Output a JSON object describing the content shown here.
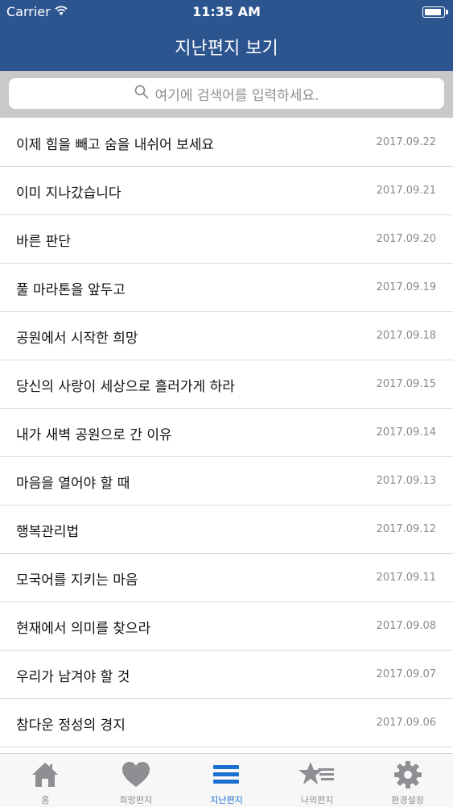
{
  "status_bar": {
    "carrier": "Carrier",
    "time": "11:35 AM"
  },
  "header": {
    "title": "지난편지 보기"
  },
  "search": {
    "placeholder": "여기에 검색어를 입력하세요."
  },
  "letters": [
    {
      "title": "이제 힘을 빼고 숨을 내쉬어 보세요",
      "date": "2017.09.22"
    },
    {
      "title": "이미 지나갔습니다",
      "date": "2017.09.21"
    },
    {
      "title": "바른 판단",
      "date": "2017.09.20"
    },
    {
      "title": "풀 마라톤을 앞두고",
      "date": "2017.09.19"
    },
    {
      "title": "공원에서 시작한 희망",
      "date": "2017.09.18"
    },
    {
      "title": "당신의 사랑이 세상으로 흘러가게 하라",
      "date": "2017.09.15"
    },
    {
      "title": "내가 새벽 공원으로 간 이유",
      "date": "2017.09.14"
    },
    {
      "title": "마음을 열어야 할 때",
      "date": "2017.09.13"
    },
    {
      "title": "행복관리법",
      "date": "2017.09.12"
    },
    {
      "title": "모국어를 지키는 마음",
      "date": "2017.09.11"
    },
    {
      "title": "현재에서 의미를 찾으라",
      "date": "2017.09.08"
    },
    {
      "title": "우리가 남겨야 할 것",
      "date": "2017.09.07"
    },
    {
      "title": "참다운 정성의 경지",
      "date": "2017.09.06"
    }
  ],
  "tabbar": {
    "tabs": [
      {
        "label": "홈",
        "icon": "home-icon"
      },
      {
        "label": "희망편지",
        "icon": "heart-icon"
      },
      {
        "label": "지난편지",
        "icon": "list-icon"
      },
      {
        "label": "나의편지",
        "icon": "star-icon"
      },
      {
        "label": "환경설정",
        "icon": "gear-icon"
      }
    ],
    "active_color": "#1b6fd0",
    "inactive_color": "#8e8e93"
  },
  "colors": {
    "header_bg": "#2c5590",
    "search_bg": "#c9c9cc"
  }
}
